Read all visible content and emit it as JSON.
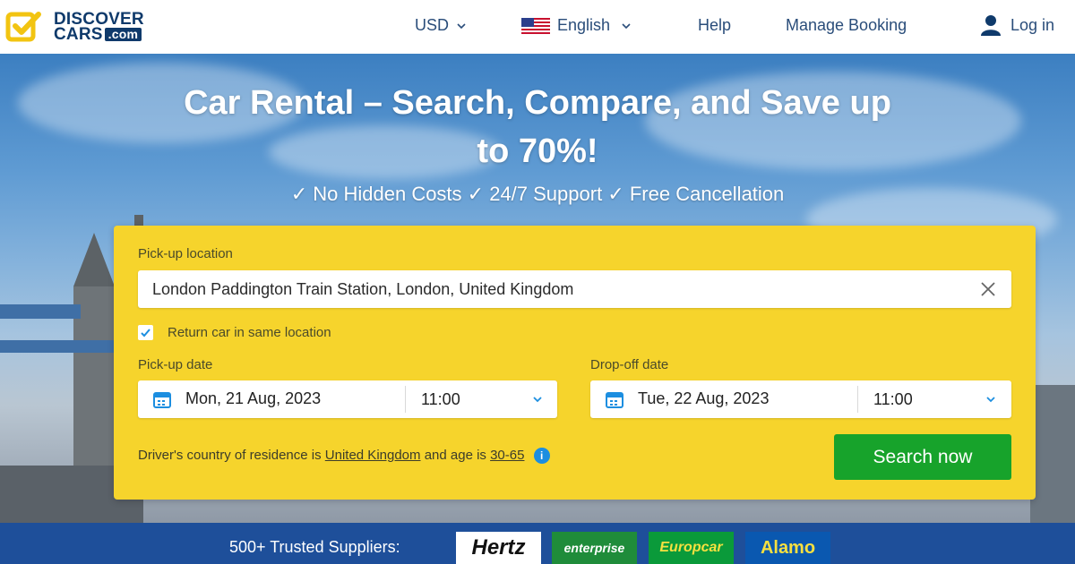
{
  "logo": {
    "line1": "DISCOVER",
    "line2": "CARS",
    "tld": ".com"
  },
  "nav": {
    "currency": "USD",
    "language": "English",
    "help": "Help",
    "manage_booking": "Manage Booking",
    "login": "Log in"
  },
  "hero": {
    "title_line1": "Car Rental – Search, Compare, and Save up",
    "title_line2": "to 70%!",
    "subtitle": "✓ No Hidden Costs ✓ 24/7 Support ✓ Free Cancellation"
  },
  "search": {
    "pickup_location_label": "Pick-up location",
    "pickup_location_value": "London Paddington Train Station, London, United Kingdom",
    "return_same_label": "Return car in same location",
    "return_same_checked": true,
    "pickup_date_label": "Pick-up date",
    "pickup_date": "Mon, 21 Aug, 2023",
    "pickup_time": "11:00",
    "dropoff_date_label": "Drop-off date",
    "dropoff_date": "Tue, 22 Aug, 2023",
    "dropoff_time": "11:00",
    "driver_prefix": "Driver's country of residence is",
    "driver_country": "United Kingdom",
    "driver_mid": "and age is",
    "driver_age": "30-65",
    "search_button": "Search now"
  },
  "suppliers": {
    "label": "500+ Trusted Suppliers:",
    "logos": [
      "Hertz",
      "enterprise",
      "Europcar",
      "Alamo"
    ]
  },
  "colors": {
    "brand_navy": "#0f3a6b",
    "search_panel": "#f6d42c",
    "search_button": "#17a32b",
    "suppliers_bar": "#1e4f9a",
    "icon_blue": "#1c8ee0"
  }
}
